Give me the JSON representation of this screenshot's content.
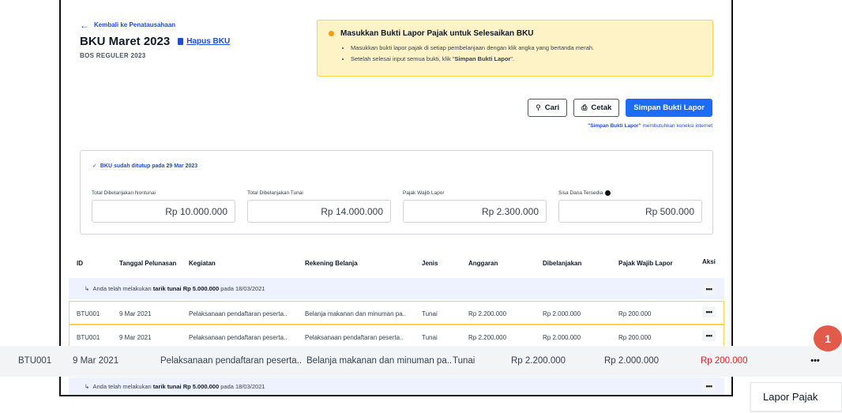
{
  "header": {
    "back_label": "Kembali ke Penatausahaan",
    "title": "BKU Maret 2023",
    "delete_label": "Hapus BKU",
    "subtitle": "BOS REGULER 2023"
  },
  "alert": {
    "title": "Masukkan Bukti Lapor Pajak untuk Selesaikan BKU",
    "item1": "Masukkan bukti lapor pajak di setiap pembelanjaan dengan klik angka yang bertanda merah.",
    "item2_prefix": "Setelah selesai input semua bukti, klik \"",
    "item2_bold": "Simpan Bukti Lapor",
    "item2_suffix": "\"."
  },
  "toolbar": {
    "search_label": "Cari",
    "print_label": "Cetak",
    "save_label": "Simpan Bukti Lapor",
    "note_bold": "\"Simpan Bukti Lapor\"",
    "note_rest": " membutuhkan koneksi internet"
  },
  "summary": {
    "closed_note": "BKU sudah ditutup pada 29 Mar 2023",
    "stats": [
      {
        "label": "Total Dibelanjakan Nontunai",
        "value": "Rp 10.000.000"
      },
      {
        "label": "Total Dibelanjakan Tunai",
        "value": "Rp 14.000.000"
      },
      {
        "label": "Pajak Wajib Lapor",
        "value": "Rp 2.300.000"
      },
      {
        "label": "Sisa Dana Tersedia",
        "value": "Rp 500.000"
      }
    ]
  },
  "table": {
    "headers": {
      "id": "ID",
      "tanggal": "Tanggal Pelunasan",
      "kegiatan": "Kegiatan",
      "rekening": "Rekening Belanja",
      "jenis": "Jenis",
      "anggaran": "Anggaran",
      "dibelanjakan": "Dibelanjakan",
      "pajak": "Pajak Wajib Lapor",
      "aksi": "Aksi"
    },
    "tarik": {
      "prefix": "Anda telah melakukan ",
      "bold": "tarik tunai Rp 5.000.000",
      "suffix": " pada 18/03/2021"
    },
    "rows": [
      {
        "id": "BTU001",
        "tanggal": "9 Mar 2021",
        "kegiatan": "Pelaksanaan pendaftaran peserta..",
        "rekening": "Belanja makanan dan minuman pa..",
        "jenis": "Tunai",
        "anggaran": "Rp 2.200.000",
        "dibelanjakan": "Rp 2.000.000",
        "pajak": "Rp 200.000"
      },
      {
        "id": "BTU001",
        "tanggal": "9 Mar 2021",
        "kegiatan": "Pelaksanaan pendaftaran peserta..",
        "rekening": "Pelaksanaan pendaftaran peserta..",
        "jenis": "Tunai",
        "anggaran": "Rp 2.200.000",
        "dibelanjakan": "Rp 2.000.000",
        "pajak": "Rp 200.000"
      }
    ],
    "overlay_row": {
      "id": "BTU001",
      "tanggal": "9 Mar 2021",
      "kegiatan": "Pelaksanaan pendaftaran peserta..",
      "rekening": "Belanja makanan dan minuman pa..",
      "jenis": "Tunai",
      "anggaran": "Rp 2.200.000",
      "dibelanjakan": "Rp 2.000.000",
      "pajak": "Rp 200.000"
    }
  },
  "more_glyph": "•••",
  "badge_number": "1",
  "menu": {
    "item": "Lapor Pajak"
  },
  "colors": {
    "primary": "#1d6cf5",
    "warning_bg": "#fef3c7",
    "danger": "#dc2626",
    "badge": "#e25a4a"
  }
}
